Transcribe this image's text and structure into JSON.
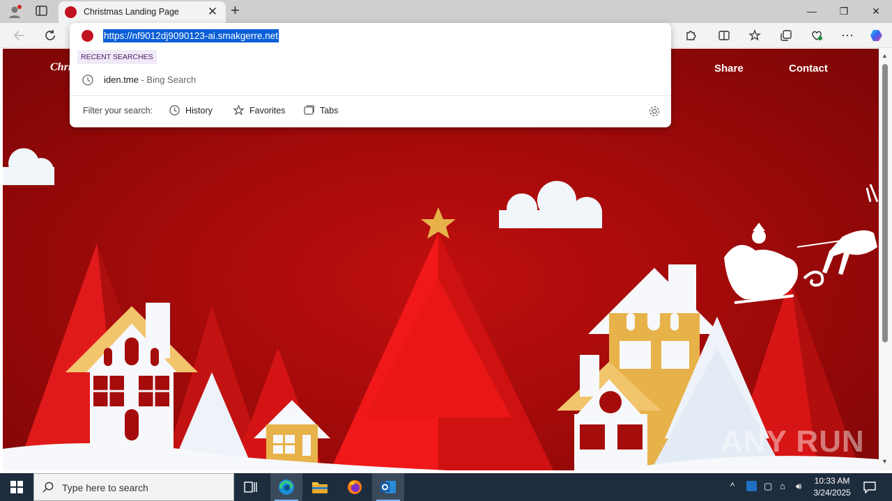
{
  "browser": {
    "tab_title": "Christmas Landing Page",
    "tab_close": "✕",
    "new_tab": "+",
    "minimize": "—",
    "restore": "❐",
    "close": "✕",
    "toolbar_icons": [
      "back-icon",
      "refresh-icon",
      "extensions-icon",
      "split-screen-icon",
      "favorites-icon",
      "collections-icon",
      "performance-icon",
      "more-icon",
      "copilot-icon"
    ]
  },
  "omnibox": {
    "url": "https://nf9012dj9090123-ai.smakgerre.net",
    "recent_label": "RECENT SEARCHES",
    "suggestion_text": "iden.tme",
    "suggestion_source": " - Bing Search",
    "filter_label": "Filter your search:",
    "filters": {
      "history": "History",
      "favorites": "Favorites",
      "tabs": "Tabs"
    }
  },
  "page": {
    "brand": "Chri",
    "nav": {
      "share": "Share",
      "contact": "Contact"
    },
    "watermark": "ANY RUN"
  },
  "taskbar": {
    "search_placeholder": "Type here to search",
    "time": "10:33 AM",
    "date": "3/24/2025",
    "apps": [
      "task-view-icon",
      "edge-icon",
      "file-explorer-icon",
      "firefox-icon",
      "outlook-icon"
    ]
  },
  "colors": {
    "page_red": "#b00c0c",
    "url_highlight": "#0a5fd6",
    "taskbar": "#1e2d3d"
  }
}
